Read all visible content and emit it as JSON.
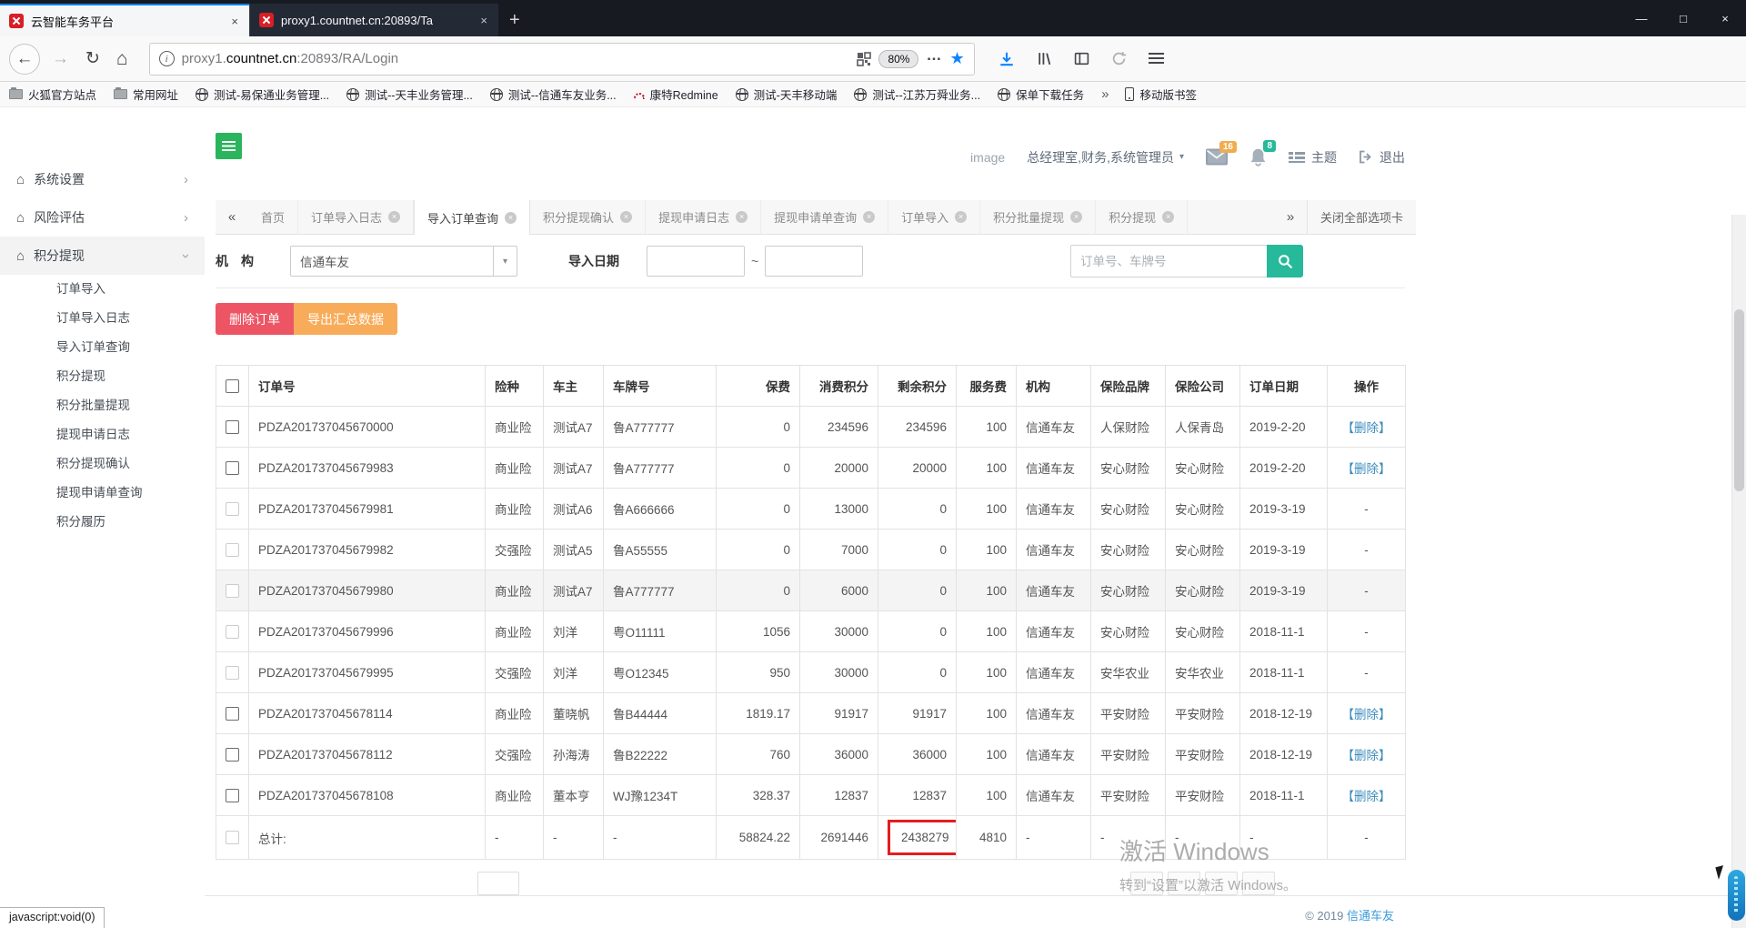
{
  "browser": {
    "window_tabs": [
      {
        "title": "云智能车务平台",
        "active": true
      },
      {
        "title": "proxy1.countnet.cn:20893/Ta",
        "active": false
      }
    ],
    "new_tab": "+",
    "window_controls": {
      "minimize": "—",
      "maximize": "□",
      "close": "×"
    },
    "url": {
      "sub": "proxy1.",
      "domain": "countnet.cn",
      "path": ":20893/RA/Login"
    },
    "zoom_badge": "80%",
    "page_actions_dots": "…",
    "bookmarks": [
      {
        "label": "火狐官方站点",
        "icon": "folder"
      },
      {
        "label": "常用网址",
        "icon": "folder"
      },
      {
        "label": "测试-易保通业务管理...",
        "icon": "globe"
      },
      {
        "label": "测试--天丰业务管理...",
        "icon": "globe"
      },
      {
        "label": "测试--信通车友业务...",
        "icon": "globe"
      },
      {
        "label": "康特Redmine",
        "icon": "redmine"
      },
      {
        "label": "测试-天丰移动端",
        "icon": "globe"
      },
      {
        "label": "测试--江苏万舜业务...",
        "icon": "globe"
      },
      {
        "label": "保单下载任务",
        "icon": "globe"
      }
    ],
    "bookmarks_overflow": "»",
    "mobile_bookmarks": "移动版书签",
    "status_text": "javascript:void(0)"
  },
  "icons": {
    "back": "←",
    "forward": "→",
    "reload": "↻",
    "home": "⌂",
    "star": "★",
    "chev_right": "›",
    "scroll_left": "«",
    "scroll_right": "»",
    "caret_down": "▾",
    "info": "i"
  },
  "app": {
    "header": {
      "avatar_alt": "image",
      "user_roles": "总经理室,财务,系统管理员",
      "mail_count": "16",
      "bell_count": "8",
      "theme_label": "主题",
      "logout_label": "退出"
    },
    "sidebar": {
      "parents": [
        {
          "label": "系统设置",
          "expanded": false
        },
        {
          "label": "风险评估",
          "expanded": false
        },
        {
          "label": "积分提现",
          "expanded": true
        }
      ],
      "submenu": [
        "订单导入",
        "订单导入日志",
        "导入订单查询",
        "积分提现",
        "积分批量提现",
        "提现申请日志",
        "积分提现确认",
        "提现申请单查询",
        "积分履历"
      ]
    },
    "tabbar": {
      "tabs": [
        {
          "label": "首页",
          "closable": false,
          "active": false
        },
        {
          "label": "订单导入日志",
          "closable": true,
          "active": false
        },
        {
          "label": "导入订单查询",
          "closable": true,
          "active": true
        },
        {
          "label": "积分提现确认",
          "closable": true,
          "active": false
        },
        {
          "label": "提现申请日志",
          "closable": true,
          "active": false
        },
        {
          "label": "提现申请单查询",
          "closable": true,
          "active": false
        },
        {
          "label": "订单导入",
          "closable": true,
          "active": false
        },
        {
          "label": "积分批量提现",
          "closable": true,
          "active": false
        },
        {
          "label": "积分提现",
          "closable": true,
          "active": false
        }
      ],
      "close_all": "关闭全部选项卡"
    },
    "filters": {
      "org_label": "机　构",
      "org_value": "信通车友",
      "date_label": "导入日期",
      "tilde": "~",
      "search_placeholder": "订单号、车牌号"
    },
    "buttons": {
      "delete": "删除订单",
      "export": "导出汇总数据"
    },
    "table": {
      "columns": [
        {
          "key": "check",
          "label": "",
          "align": "ac"
        },
        {
          "key": "order_no",
          "label": "订单号",
          "align": "al"
        },
        {
          "key": "ins",
          "label": "险种",
          "align": "al"
        },
        {
          "key": "owner",
          "label": "车主",
          "align": "al"
        },
        {
          "key": "plate",
          "label": "车牌号",
          "align": "al"
        },
        {
          "key": "premium",
          "label": "保费",
          "align": "ar"
        },
        {
          "key": "consumed",
          "label": "消费积分",
          "align": "ar"
        },
        {
          "key": "remaining",
          "label": "剩余积分",
          "align": "ar"
        },
        {
          "key": "fee",
          "label": "服务费",
          "align": "ar"
        },
        {
          "key": "org",
          "label": "机构",
          "align": "al"
        },
        {
          "key": "brand",
          "label": "保险品牌",
          "align": "al"
        },
        {
          "key": "company",
          "label": "保险公司",
          "align": "al"
        },
        {
          "key": "date",
          "label": "订单日期",
          "align": "al"
        },
        {
          "key": "action",
          "label": "操作",
          "align": "ac"
        }
      ],
      "rows": [
        {
          "order_no": "PDZA201737045670000",
          "ins": "商业险",
          "owner": "测试A7",
          "plate": "鲁A777777",
          "premium": "0",
          "consumed": "234596",
          "remaining": "234596",
          "fee": "100",
          "org": "信通车友",
          "brand": "人保财险",
          "company": "人保青岛",
          "date": "2019-2-20",
          "action": "【删除】",
          "cb_enabled": true,
          "hover": false
        },
        {
          "order_no": "PDZA201737045679983",
          "ins": "商业险",
          "owner": "测试A7",
          "plate": "鲁A777777",
          "premium": "0",
          "consumed": "20000",
          "remaining": "20000",
          "fee": "100",
          "org": "信通车友",
          "brand": "安心财险",
          "company": "安心财险",
          "date": "2019-2-20",
          "action": "【删除】",
          "cb_enabled": true,
          "hover": false
        },
        {
          "order_no": "PDZA201737045679981",
          "ins": "商业险",
          "owner": "测试A6",
          "plate": "鲁A666666",
          "premium": "0",
          "consumed": "13000",
          "remaining": "0",
          "fee": "100",
          "org": "信通车友",
          "brand": "安心财险",
          "company": "安心财险",
          "date": "2019-3-19",
          "action": "-",
          "cb_enabled": false,
          "hover": false
        },
        {
          "order_no": "PDZA201737045679982",
          "ins": "交强险",
          "owner": "测试A5",
          "plate": "鲁A55555",
          "premium": "0",
          "consumed": "7000",
          "remaining": "0",
          "fee": "100",
          "org": "信通车友",
          "brand": "安心财险",
          "company": "安心财险",
          "date": "2019-3-19",
          "action": "-",
          "cb_enabled": false,
          "hover": false
        },
        {
          "order_no": "PDZA201737045679980",
          "ins": "商业险",
          "owner": "测试A7",
          "plate": "鲁A777777",
          "premium": "0",
          "consumed": "6000",
          "remaining": "0",
          "fee": "100",
          "org": "信通车友",
          "brand": "安心财险",
          "company": "安心财险",
          "date": "2019-3-19",
          "action": "-",
          "cb_enabled": false,
          "hover": true
        },
        {
          "order_no": "PDZA201737045679996",
          "ins": "商业险",
          "owner": "刘洋",
          "plate": "粤O11111",
          "premium": "1056",
          "consumed": "30000",
          "remaining": "0",
          "fee": "100",
          "org": "信通车友",
          "brand": "安心财险",
          "company": "安心财险",
          "date": "2018-11-1",
          "action": "-",
          "cb_enabled": false,
          "hover": false
        },
        {
          "order_no": "PDZA201737045679995",
          "ins": "交强险",
          "owner": "刘洋",
          "plate": "粤O12345",
          "premium": "950",
          "consumed": "30000",
          "remaining": "0",
          "fee": "100",
          "org": "信通车友",
          "brand": "安华农业",
          "company": "安华农业",
          "date": "2018-11-1",
          "action": "-",
          "cb_enabled": false,
          "hover": false
        },
        {
          "order_no": "PDZA201737045678114",
          "ins": "商业险",
          "owner": "董晓帆",
          "plate": "鲁B44444",
          "premium": "1819.17",
          "consumed": "91917",
          "remaining": "91917",
          "fee": "100",
          "org": "信通车友",
          "brand": "平安财险",
          "company": "平安财险",
          "date": "2018-12-19",
          "action": "【删除】",
          "cb_enabled": true,
          "hover": false
        },
        {
          "order_no": "PDZA201737045678112",
          "ins": "交强险",
          "owner": "孙海涛",
          "plate": "鲁B22222",
          "premium": "760",
          "consumed": "36000",
          "remaining": "36000",
          "fee": "100",
          "org": "信通车友",
          "brand": "平安财险",
          "company": "平安财险",
          "date": "2018-12-19",
          "action": "【删除】",
          "cb_enabled": true,
          "hover": false
        },
        {
          "order_no": "PDZA201737045678108",
          "ins": "商业险",
          "owner": "董本亨",
          "plate": "WJ豫1234T",
          "premium": "328.37",
          "consumed": "12837",
          "remaining": "12837",
          "fee": "100",
          "org": "信通车友",
          "brand": "平安财险",
          "company": "平安财险",
          "date": "2018-11-1",
          "action": "【删除】",
          "cb_enabled": true,
          "hover": false
        }
      ],
      "total": {
        "order_no": "总计:",
        "ins": "-",
        "owner": "-",
        "plate": "-",
        "premium": "58824.22",
        "consumed": "2691446",
        "remaining": "2438279",
        "fee": "4810",
        "org": "-",
        "brand": "-",
        "company": "-",
        "date": "-",
        "action": "-"
      }
    },
    "watermark": {
      "line1": "激活 Windows",
      "line2": "转到“设置”以激活 Windows。"
    },
    "footer": {
      "copyright": "© 2019",
      "brand": "信通车友"
    }
  }
}
